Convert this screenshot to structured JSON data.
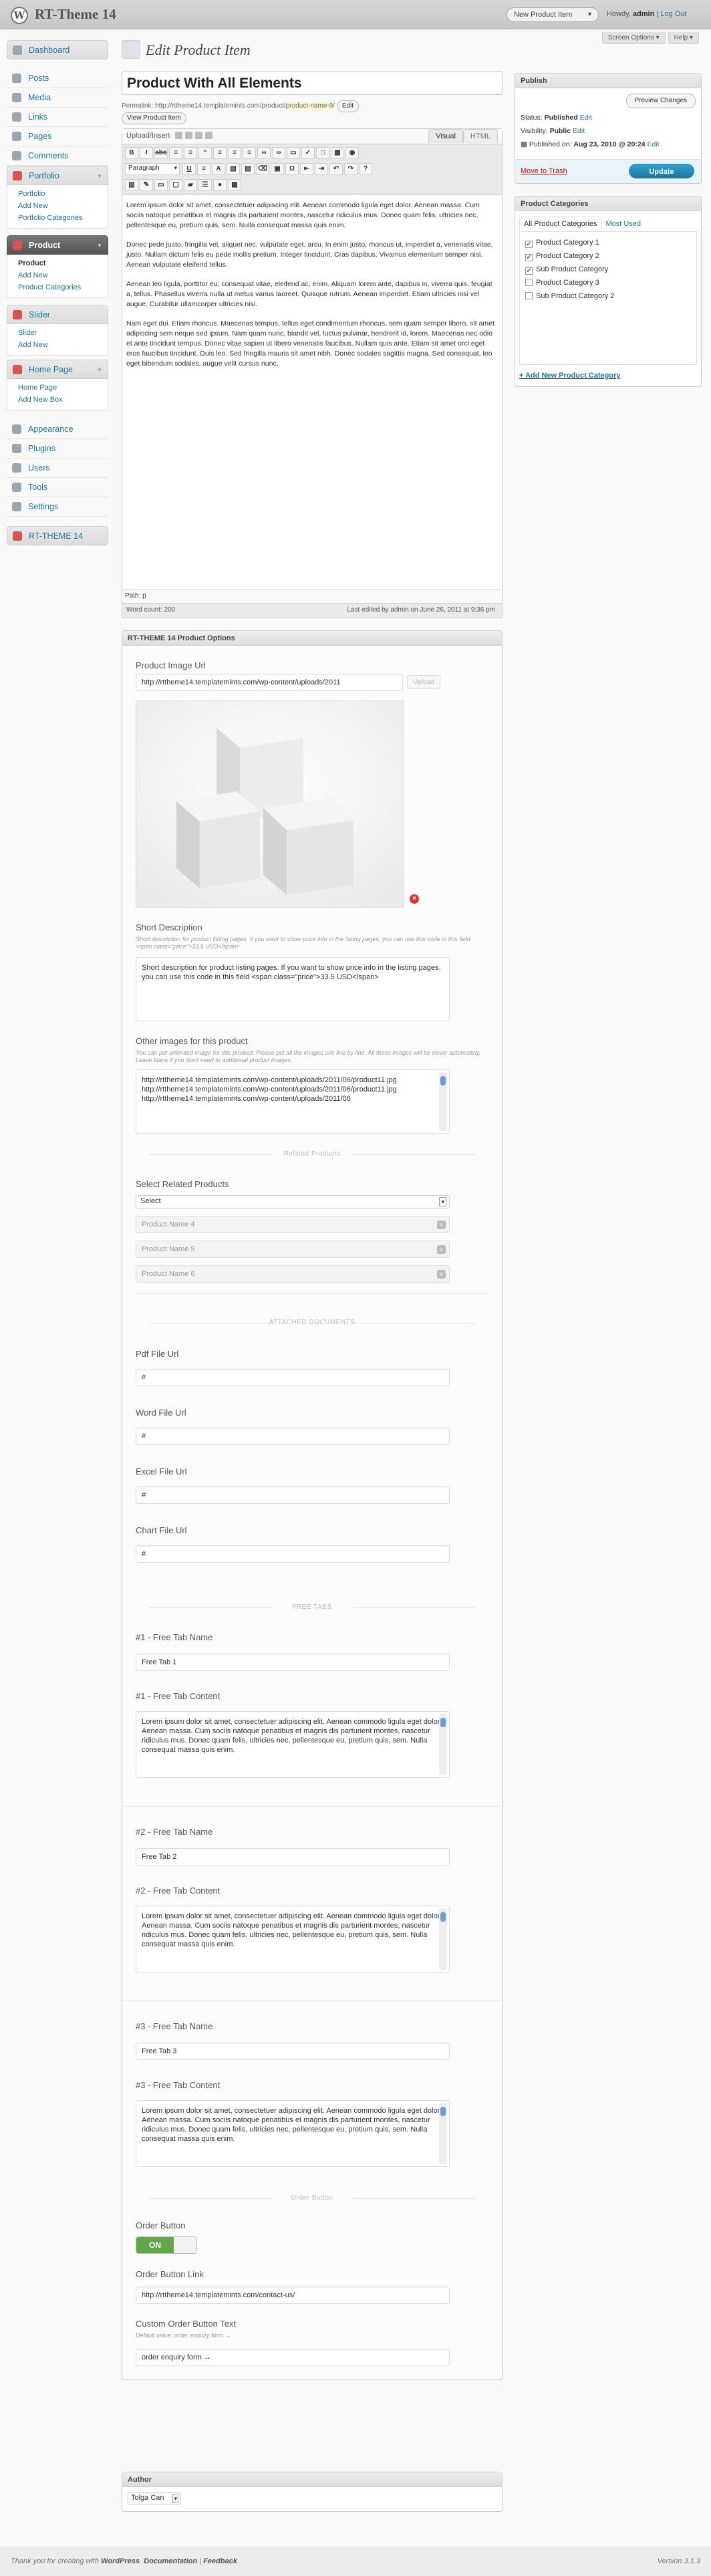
{
  "adminbar": {
    "site_name": "RT-Theme 14",
    "new_item": "New Product Item",
    "howdy": "Howdy,",
    "user": "admin",
    "sep": "|",
    "logout": "Log Out",
    "logo_glyph": "W"
  },
  "screen_tabs": {
    "screen_options": "Screen Options ▾",
    "help": "Help ▾"
  },
  "sidebar": {
    "dashboard": "Dashboard",
    "posts": "Posts",
    "media": "Media",
    "links": "Links",
    "pages": "Pages",
    "comments": "Comments",
    "portfolio": {
      "label": "Portfolio",
      "items": [
        "Portfolio",
        "Add New",
        "Portfolio Categories"
      ]
    },
    "product": {
      "label": "Product",
      "items": [
        "Product",
        "Add New",
        "Product Categories"
      ]
    },
    "slider": {
      "label": "Slider",
      "items": [
        "Slider",
        "Add New"
      ]
    },
    "homepage": {
      "label": "Home Page",
      "items": [
        "Home Page",
        "Add New Box"
      ]
    },
    "appearance": "Appearance",
    "plugins": "Plugins",
    "users": "Users",
    "tools": "Tools",
    "settings": "Settings",
    "rt_theme": "RT-THEME 14"
  },
  "page": {
    "title": "Edit Product Item"
  },
  "post": {
    "title": "Product With All Elements",
    "permalink_label": "Permalink:",
    "permalink_base": "http://rttheme14.templatemints.com/product/",
    "permalink_slug": "product-name-9",
    "permalink_end": "/",
    "edit_btn": "Edit",
    "view_btn": "View Product Item"
  },
  "editor": {
    "upload_insert": "Upload/Insert",
    "tab_visual": "Visual",
    "tab_html": "HTML",
    "format": "Paragraph",
    "paragraphs": [
      "Lorem ipsum dolor sit amet, consectetuer adipiscing elit. Aenean commodo ligula eget dolor. Aenean massa. Cum sociis natoque penatibus et magnis dis parturient montes, nascetur ridiculus mus. Donec quam felis, ultricies nec, pellentesque eu, pretium quis, sem. Nulla consequat massa quis enim.",
      "Donec pede justo, fringilla vel, aliquet nec, vulputate eget, arcu. In enim justo, rhoncus ut, imperdiet a, venenatis vitae, justo. Nullam dictum felis eu pede mollis pretium. Integer tincidunt. Cras dapibus. Vivamus elementum semper nisi. Aenean vulputate eleifend tellus.",
      "Aenean leo ligula, porttitor eu, consequat vitae, eleifend ac, enim. Aliquam lorem ante, dapibus in, viverra quis, feugiat a, tellus. Phasellus viverra nulla ut metus varius laoreet. Quisque rutrum. Aenean imperdiet. Etiam ultricies nisi vel augue. Curabitur ullamcorper ultricies nisi.",
      "Nam eget dui. Etiam rhoncus. Maecenas tempus, tellus eget condimentum rhoncus, sem quam semper libero, sit amet adipiscing sem neque sed ipsum. Nam quam nunc, blandit vel, luctus pulvinar, hendrerit id, lorem. Maecenas nec odio et ante tincidunt tempus. Donec vitae sapien ut libero venenatis faucibus. Nullam quis ante. Etiam sit amet orci eget eros faucibus tincidunt. Duis leo. Sed fringilla mauris sit amet nibh. Donec sodales sagittis magna. Sed consequat, leo eget bibendum sodales, augue velit cursus nunc,"
    ],
    "path": "Path: p",
    "word_count": "Word count: 200",
    "last_edited": "Last edited by admin on June 26, 2011 at 9:36 pm"
  },
  "options": {
    "title": "RT-THEME 14 Product Options",
    "image_label": "Product Image Url",
    "image_url": "http://rttheme14.templatemints.com/wp-content/uploads/2011",
    "upload_btn": "Upload",
    "remove_glyph": "×",
    "short_label": "Short Description",
    "short_desc": "Short description for product listing pages. If you want to show price info in the listing pages, you can use this code in this field <span class=\"price\">33.5 USD</span>",
    "short_value": "Short description for product listing pages. If you want to show price info in the listing pages, you can use this code in this field <span class=\"price\">33.5 USD</span>",
    "other_label": "Other images for this product",
    "other_desc": "You can put unlimited image for this product. Please put all the images urls line by line. All these images will be viewe automaticly. Leave blank if you don't need to additional product images.",
    "other_value": "http://rttheme14.templatemints.com/wp-content/uploads/2011/06/product11.jpg\nhttp://rttheme14.templatemints.com/wp-content/uploads/2011/06/product11.jpg\nhttp://rttheme14.templatemints.com/wp-content/uploads/2011/06",
    "related_sec": "Related Products",
    "related_label": "Select Related Products",
    "related_select": "Select",
    "related_items": [
      "Product Name 4",
      "Product Name 5",
      "Product Name 6"
    ],
    "remove_item": "x",
    "attached_sec": "ATTACHED DOCUMENTS",
    "pdf_label": "Pdf File Url",
    "pdf_value": "#",
    "word_label": "Word File Url",
    "word_value": "#",
    "excel_label": "Excel File Url",
    "excel_value": "#",
    "chart_label": "Chart File Url",
    "chart_value": "#",
    "free_sec": "FREE TABS",
    "tabs": [
      {
        "name_label": "#1 - Free Tab Name",
        "name": "Free Tab 1",
        "content_label": "#1 - Free Tab Content",
        "content": "Lorem ipsum dolor sit amet, consectetuer adipiscing elit. Aenean commodo ligula eget dolor. Aenean massa. Cum sociis natoque penatibus et magnis dis parturient montes, nascetur ridiculus mus. Donec quam felis, ultricies nec, pellentesque eu, pretium quis, sem. Nulla consequat massa quis enim."
      },
      {
        "name_label": "#2 - Free Tab Name",
        "name": "Free Tab 2",
        "content_label": "#2 - Free Tab Content",
        "content": "Lorem ipsum dolor sit amet, consectetuer adipiscing elit. Aenean commodo ligula eget dolor. Aenean massa. Cum sociis natoque penatibus et magnis dis parturient montes, nascetur ridiculus mus. Donec quam felis, ultricies nec, pellentesque eu, pretium quis, sem. Nulla consequat massa quis enim."
      },
      {
        "name_label": "#3 - Free Tab Name",
        "name": "Free Tab 3",
        "content_label": "#3 - Free Tab Content",
        "content": "Lorem ipsum dolor sit amet, consectetuer adipiscing elit. Aenean commodo ligula eget dolor. Aenean massa. Cum sociis natoque penatibus et magnis dis parturient montes, nascetur ridiculus mus. Donec quam felis, ultricies nec, pellentesque eu, pretium quis, sem. Nulla consequat massa quis enim."
      }
    ],
    "order_sec": "Order Button",
    "order_label": "Order Button",
    "order_toggle": "ON",
    "order_link_label": "Order Button Link",
    "order_link": "http://rttheme14.templatemints.com/contact-us/",
    "custom_label": "Custom Order Button Text",
    "custom_desc": "Default value: order enquiry form →",
    "custom_value": "order enquiry form →"
  },
  "publish": {
    "title": "Publish",
    "preview": "Preview Changes",
    "status_label": "Status:",
    "status": "Published",
    "vis_label": "Visibility:",
    "visibility": "Public",
    "pub_label": "Published on:",
    "published": "Aug 23, 2010 @ 20:24",
    "edit": "Edit",
    "trash": "Move to Trash",
    "update": "Update"
  },
  "categories": {
    "title": "Product Categories",
    "tab_all": "All Product Categories",
    "tab_used": "Most Used",
    "items": [
      {
        "label": "Product Category 1",
        "checked": "✓"
      },
      {
        "label": "Product Category 2",
        "checked": "✓"
      },
      {
        "label": "Sub Product Category",
        "checked": "✓"
      },
      {
        "label": "Product Category 3",
        "checked": ""
      },
      {
        "label": "Sub Product Category 2",
        "checked": ""
      }
    ],
    "add_new": "+ Add New Product Category"
  },
  "author": {
    "title": "Author",
    "value": "Tolga Can"
  },
  "footer": {
    "thanks": "Thank you for creating with",
    "wp": "WordPress",
    "sep": ".",
    "docs": "Documentation",
    "sep2": "|",
    "feedback": "Feedback",
    "version": "Version 3.1.3"
  },
  "colors": {
    "accent": "#21759b",
    "update": "#21759b",
    "toggle_on": "#62a84a",
    "trash": "#bc0b0b"
  }
}
